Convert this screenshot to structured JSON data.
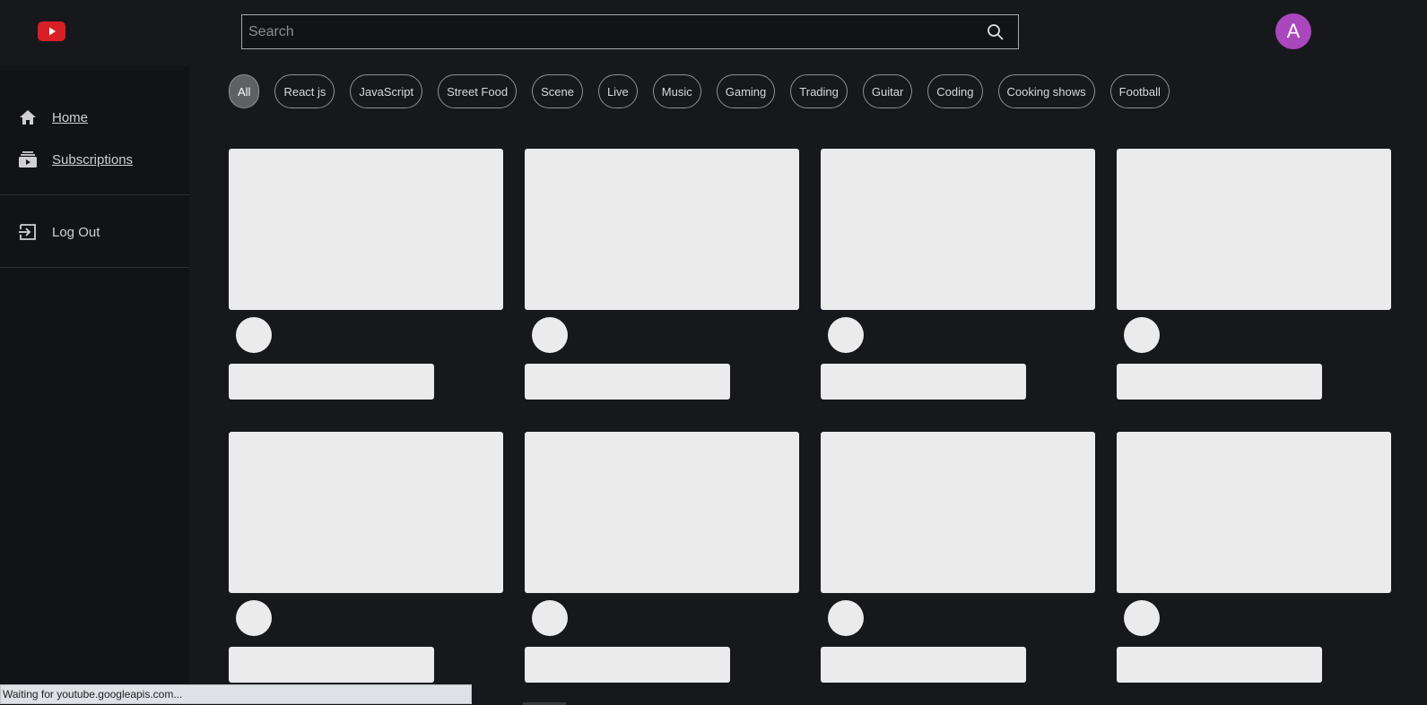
{
  "header": {
    "logo_icon": "youtube-play-icon",
    "search_placeholder": "Search",
    "search_icon": "search-icon",
    "avatar_initial": "A",
    "avatar_color": "#ab47bc"
  },
  "sidebar": {
    "items": [
      {
        "label": "Home",
        "icon": "home-icon"
      },
      {
        "label": "Subscriptions",
        "icon": "subscriptions-icon"
      }
    ],
    "logout": {
      "label": "Log Out",
      "icon": "logout-icon"
    }
  },
  "chips": [
    "All",
    "React js",
    "JavaScript",
    "Street Food",
    "Scene",
    "Live",
    "Music",
    "Gaming",
    "Trading",
    "Guitar",
    "Coding",
    "Cooking shows",
    "Football"
  ],
  "active_chip": "All",
  "video_placeholder_count": 8,
  "status_text": "Waiting for youtube.googleapis.com..."
}
